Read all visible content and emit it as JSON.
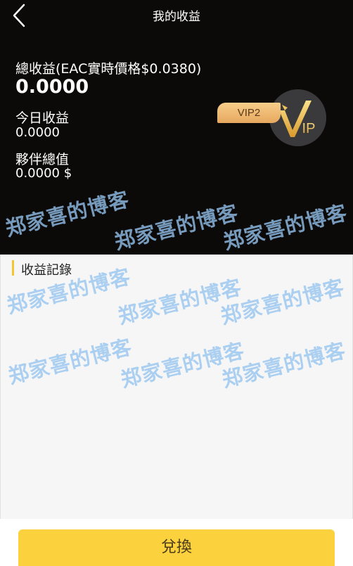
{
  "nav": {
    "title": "我的收益",
    "back_icon": "chevron-left-icon"
  },
  "summary": {
    "total_label": "總收益(EAC實時價格$0.0380)",
    "total_value": "0.0000",
    "today_label": "今日收益",
    "today_value": "0.0000",
    "partner_label": "夥伴總值",
    "partner_value": "0.0000 $"
  },
  "vip": {
    "tag_label": "VIP2",
    "badge_icon": "vip-crown-icon",
    "badge_text": "IP"
  },
  "records": {
    "section_title": "收益記錄"
  },
  "actions": {
    "exchange_label": "兌換"
  },
  "watermark": {
    "text": "郑家喜的博客"
  },
  "colors": {
    "header_bg": "#0c0a09",
    "accent": "#fbd13e",
    "vip_gold": "#e7a85f"
  }
}
